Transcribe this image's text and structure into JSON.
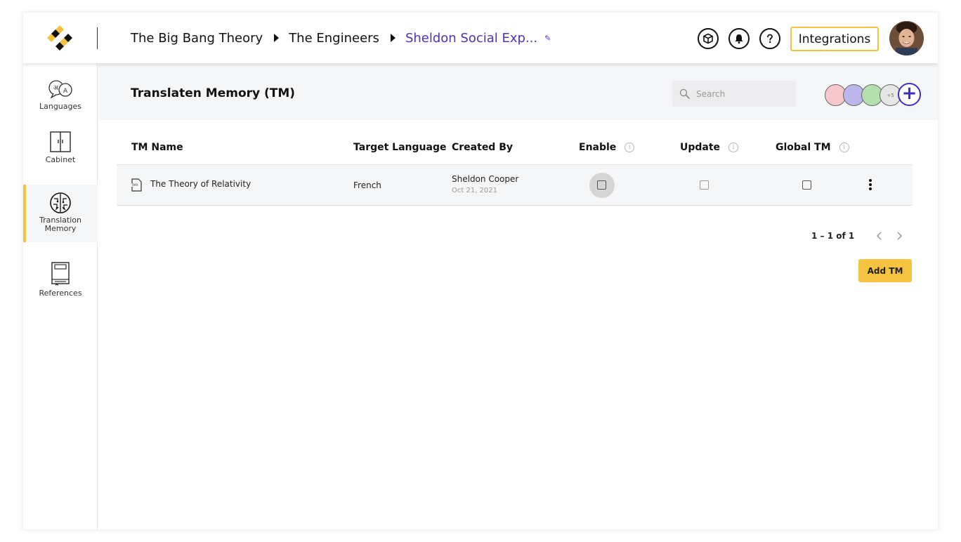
{
  "header": {
    "breadcrumbs": [
      "The Big Bang Theory",
      "The Engineers",
      "Sheldon Social Exp..."
    ],
    "integrations_label": "Integrations",
    "icons": [
      "cube-icon",
      "bell-icon",
      "help-icon"
    ]
  },
  "sidebar": {
    "items": [
      {
        "label": "Languages",
        "icon": "languages-icon"
      },
      {
        "label": "Cabinet",
        "icon": "cabinet-icon"
      },
      {
        "label": "Translation Memory",
        "icon": "brain-icon",
        "active": true
      },
      {
        "label": "References",
        "icon": "book-icon"
      }
    ]
  },
  "main": {
    "title": "Translaten Memory (TM)",
    "search_placeholder": "Search",
    "members_more": "+5",
    "table": {
      "columns": [
        "TM Name",
        "Target Language",
        "Created By",
        "Enable",
        "Update",
        "Global TM"
      ],
      "rows": [
        {
          "name": "The Theory of Relativity",
          "target_language": "French",
          "created_by": "Sheldon Cooper",
          "created_date": "Oct 21, 2021",
          "enable": false,
          "update": false,
          "global_tm": false
        }
      ]
    },
    "pagination": "1 – 1 of 1",
    "add_button": "Add TM"
  },
  "colors": {
    "accent_yellow": "#f5c242",
    "brand_purple": "#4a35b5",
    "member_colors": [
      "#f8c9cc",
      "#bdb6ea",
      "#b3e0ae",
      "#e6e6e6"
    ]
  }
}
